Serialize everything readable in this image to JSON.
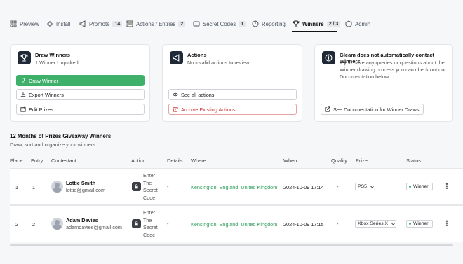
{
  "nav": {
    "items": [
      {
        "label": "Preview",
        "icon": "grid-icon"
      },
      {
        "label": "Install",
        "icon": "plug-icon"
      },
      {
        "label": "Promote",
        "icon": "megaphone-icon",
        "badge": "14"
      },
      {
        "label": "Actions / Entries",
        "icon": "list-icon",
        "badge": "2"
      },
      {
        "label": "Secret Codes",
        "icon": "code-icon",
        "badge": "1"
      },
      {
        "label": "Reporting",
        "icon": "chart-icon"
      },
      {
        "label": "Winners",
        "icon": "trophy-icon",
        "badge": "2 / 3",
        "active": true
      },
      {
        "label": "Admin",
        "icon": "shield-icon"
      }
    ]
  },
  "cards": {
    "draw": {
      "title": "Draw Winners",
      "subtitle": "1 Winner Unpicked",
      "draw_button": "Draw Winner",
      "export_button": "Export Winners",
      "edit_button": "Edit Prizes"
    },
    "actions": {
      "title": "Actions",
      "subtitle": "No invalid actions to review!",
      "see_all_button": "See all actions",
      "archive_button": "Archive Existing Actions"
    },
    "info": {
      "title": "Gleam does not automatically contact Winners",
      "body_line1": "If you have any queries or questions about the",
      "body_line2": "Winner drawing process you can check out our",
      "body_line3": "Documentation below.",
      "docs_button": "See Documentation for Winner Draws"
    }
  },
  "section": {
    "title": "12 Months of Prizes Giveaway Winners",
    "subtitle": "Draw, sort and organize your winners."
  },
  "table": {
    "headers": {
      "place": "Place",
      "entry": "Entry",
      "contestant": "Contestant",
      "action": "Action",
      "details": "Details",
      "where": "Where",
      "when": "When",
      "quality": "Quality",
      "prize": "Prize",
      "status": "Status"
    },
    "rows": [
      {
        "place": "1",
        "entry": "1",
        "name": "Lottie Smith",
        "email": "lottie@gmail.com",
        "action_l1": "Enter",
        "action_l2": "The",
        "action_l3": "Secret",
        "action_l4": "Code",
        "details": "-",
        "where": "Kensington, England, United Kingdom",
        "when": "2024-10-09 17:14",
        "quality": "-",
        "prize": "PS5",
        "status": "Winner"
      },
      {
        "place": "2",
        "entry": "2",
        "name": "Adam Davies",
        "email": "adamdavies@gmail.com",
        "action_l1": "Enter",
        "action_l2": "The",
        "action_l3": "Secret",
        "action_l4": "Code",
        "details": "-",
        "where": "Kensington, England, United Kingdom",
        "when": "2024-10-09 17:15",
        "quality": "-",
        "prize": "Xbox Series X",
        "status": "Winner"
      }
    ]
  },
  "colors": {
    "accent_green": "#3fb06a",
    "danger_red": "#d33b3b",
    "dark_icon": "#1f2937"
  }
}
